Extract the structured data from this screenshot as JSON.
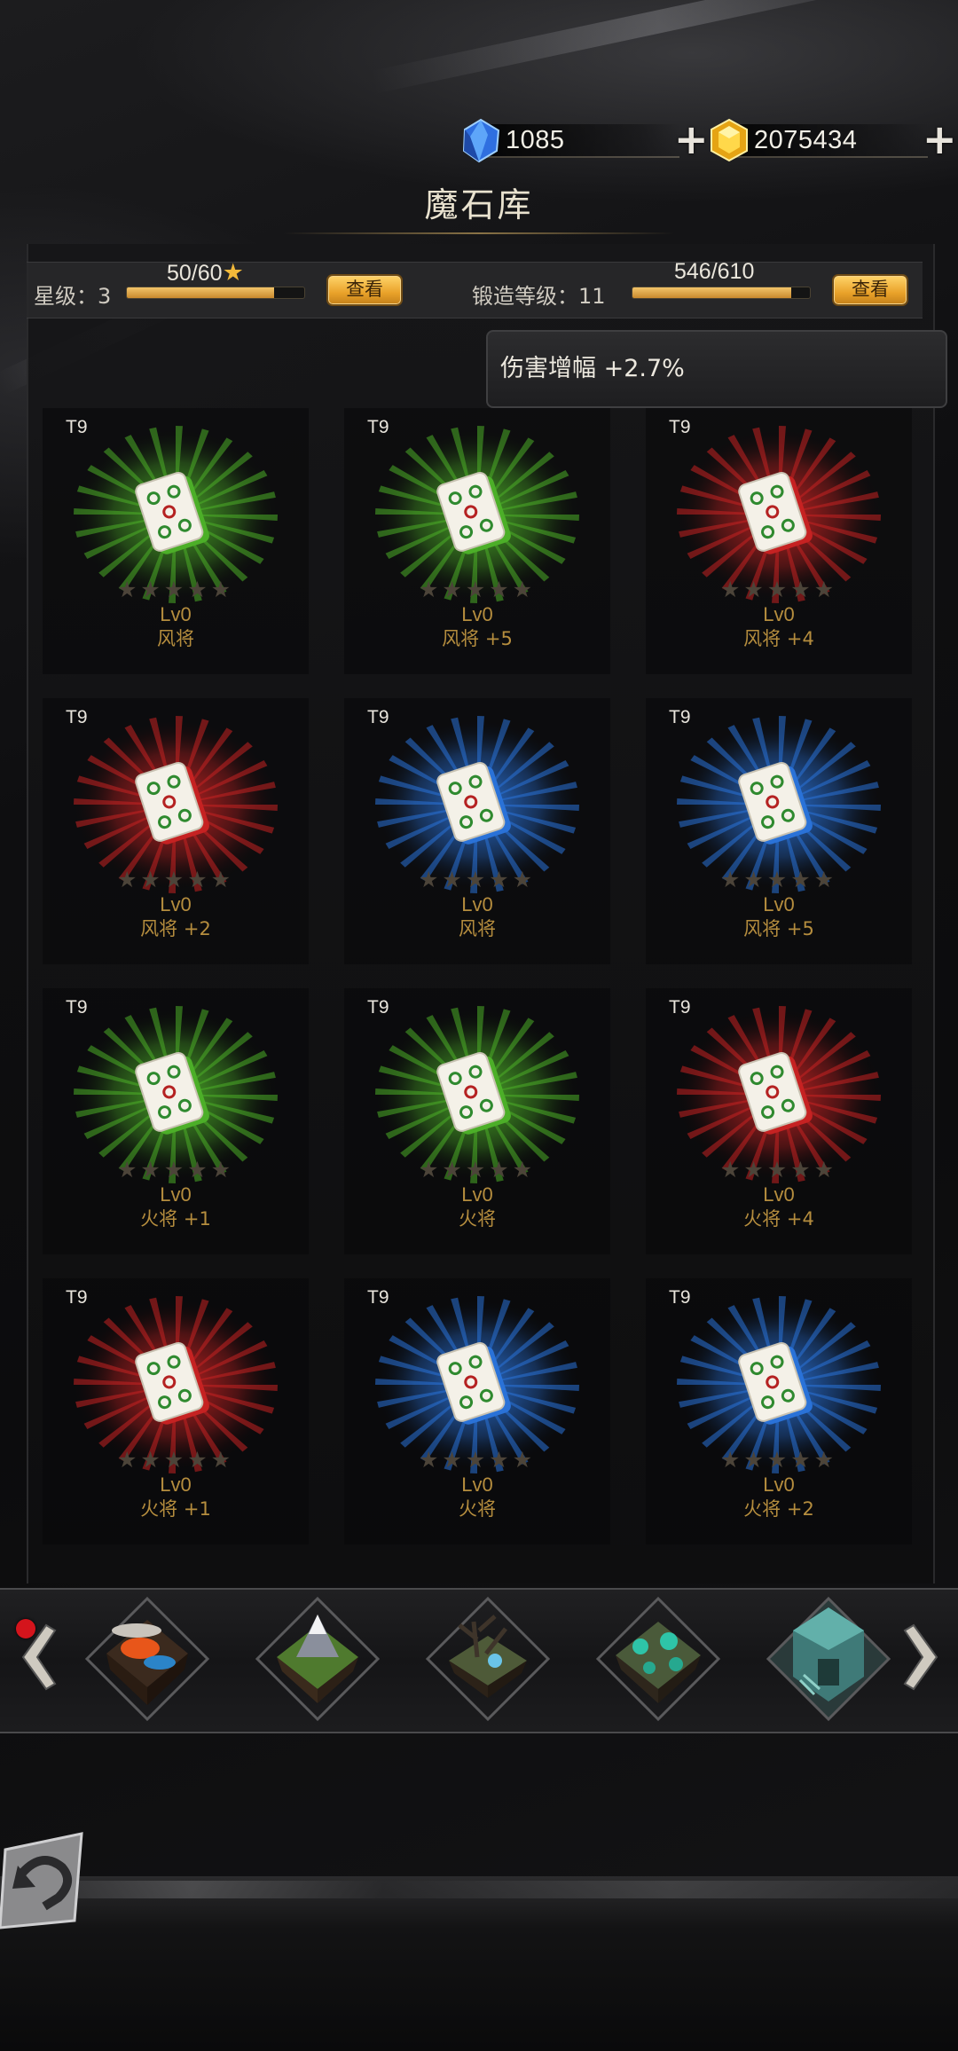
{
  "header": {
    "title": "魔石库",
    "currency": [
      {
        "icon": "blue-crystal-icon",
        "value": "1085"
      },
      {
        "icon": "gold-gem-icon",
        "value": "2075434"
      }
    ]
  },
  "stats": {
    "star_label": "星级：3",
    "star_progress_text": "50/60",
    "star_progress": 0.83,
    "star_button": "查看",
    "forge_label": "锻造等级：11",
    "forge_progress_text": "546/610",
    "forge_progress": 0.895,
    "forge_button": "查看"
  },
  "tooltip": "伤害增幅 +2.7%",
  "cards": [
    {
      "tier": "T9",
      "stars": "★★★★★",
      "level": "Lv0",
      "name": "风将",
      "color": "#4caf28"
    },
    {
      "tier": "T9",
      "stars": "★★★★★",
      "level": "Lv0",
      "name": "风将 +5",
      "color": "#4caf28"
    },
    {
      "tier": "T9",
      "stars": "★★★★★",
      "level": "Lv0",
      "name": "风将 +4",
      "color": "#c62222"
    },
    {
      "tier": "T9",
      "stars": "★★★★★",
      "level": "Lv0",
      "name": "风将 +2",
      "color": "#c62222"
    },
    {
      "tier": "T9",
      "stars": "★★★★★",
      "level": "Lv0",
      "name": "风将",
      "color": "#2a72d8"
    },
    {
      "tier": "T9",
      "stars": "★★★★★",
      "level": "Lv0",
      "name": "风将 +5",
      "color": "#2a72d8"
    },
    {
      "tier": "T9",
      "stars": "★★★★★",
      "level": "Lv0",
      "name": "火将 +1",
      "color": "#4caf28"
    },
    {
      "tier": "T9",
      "stars": "★★★★★",
      "level": "Lv0",
      "name": "火将",
      "color": "#4caf28"
    },
    {
      "tier": "T9",
      "stars": "★★★★★",
      "level": "Lv0",
      "name": "火将 +4",
      "color": "#c62222"
    },
    {
      "tier": "T9",
      "stars": "★★★★★",
      "level": "Lv0",
      "name": "火将 +1",
      "color": "#c62222"
    },
    {
      "tier": "T9",
      "stars": "★★★★★",
      "level": "Lv0",
      "name": "火将",
      "color": "#2a72d8"
    },
    {
      "tier": "T9",
      "stars": "★★★★★",
      "level": "Lv0",
      "name": "火将 +2",
      "color": "#2a72d8"
    }
  ],
  "map_strip": {
    "maps": [
      "lava-island-icon",
      "snow-mountain-island-icon",
      "dead-tree-island-icon",
      "crystal-cave-island-icon",
      "tower-island-icon"
    ],
    "left_arrow": "chevron-left-icon",
    "right_arrow": "chevron-right-icon",
    "notification": "red-dot"
  },
  "back_button": "back-arrow-icon"
}
